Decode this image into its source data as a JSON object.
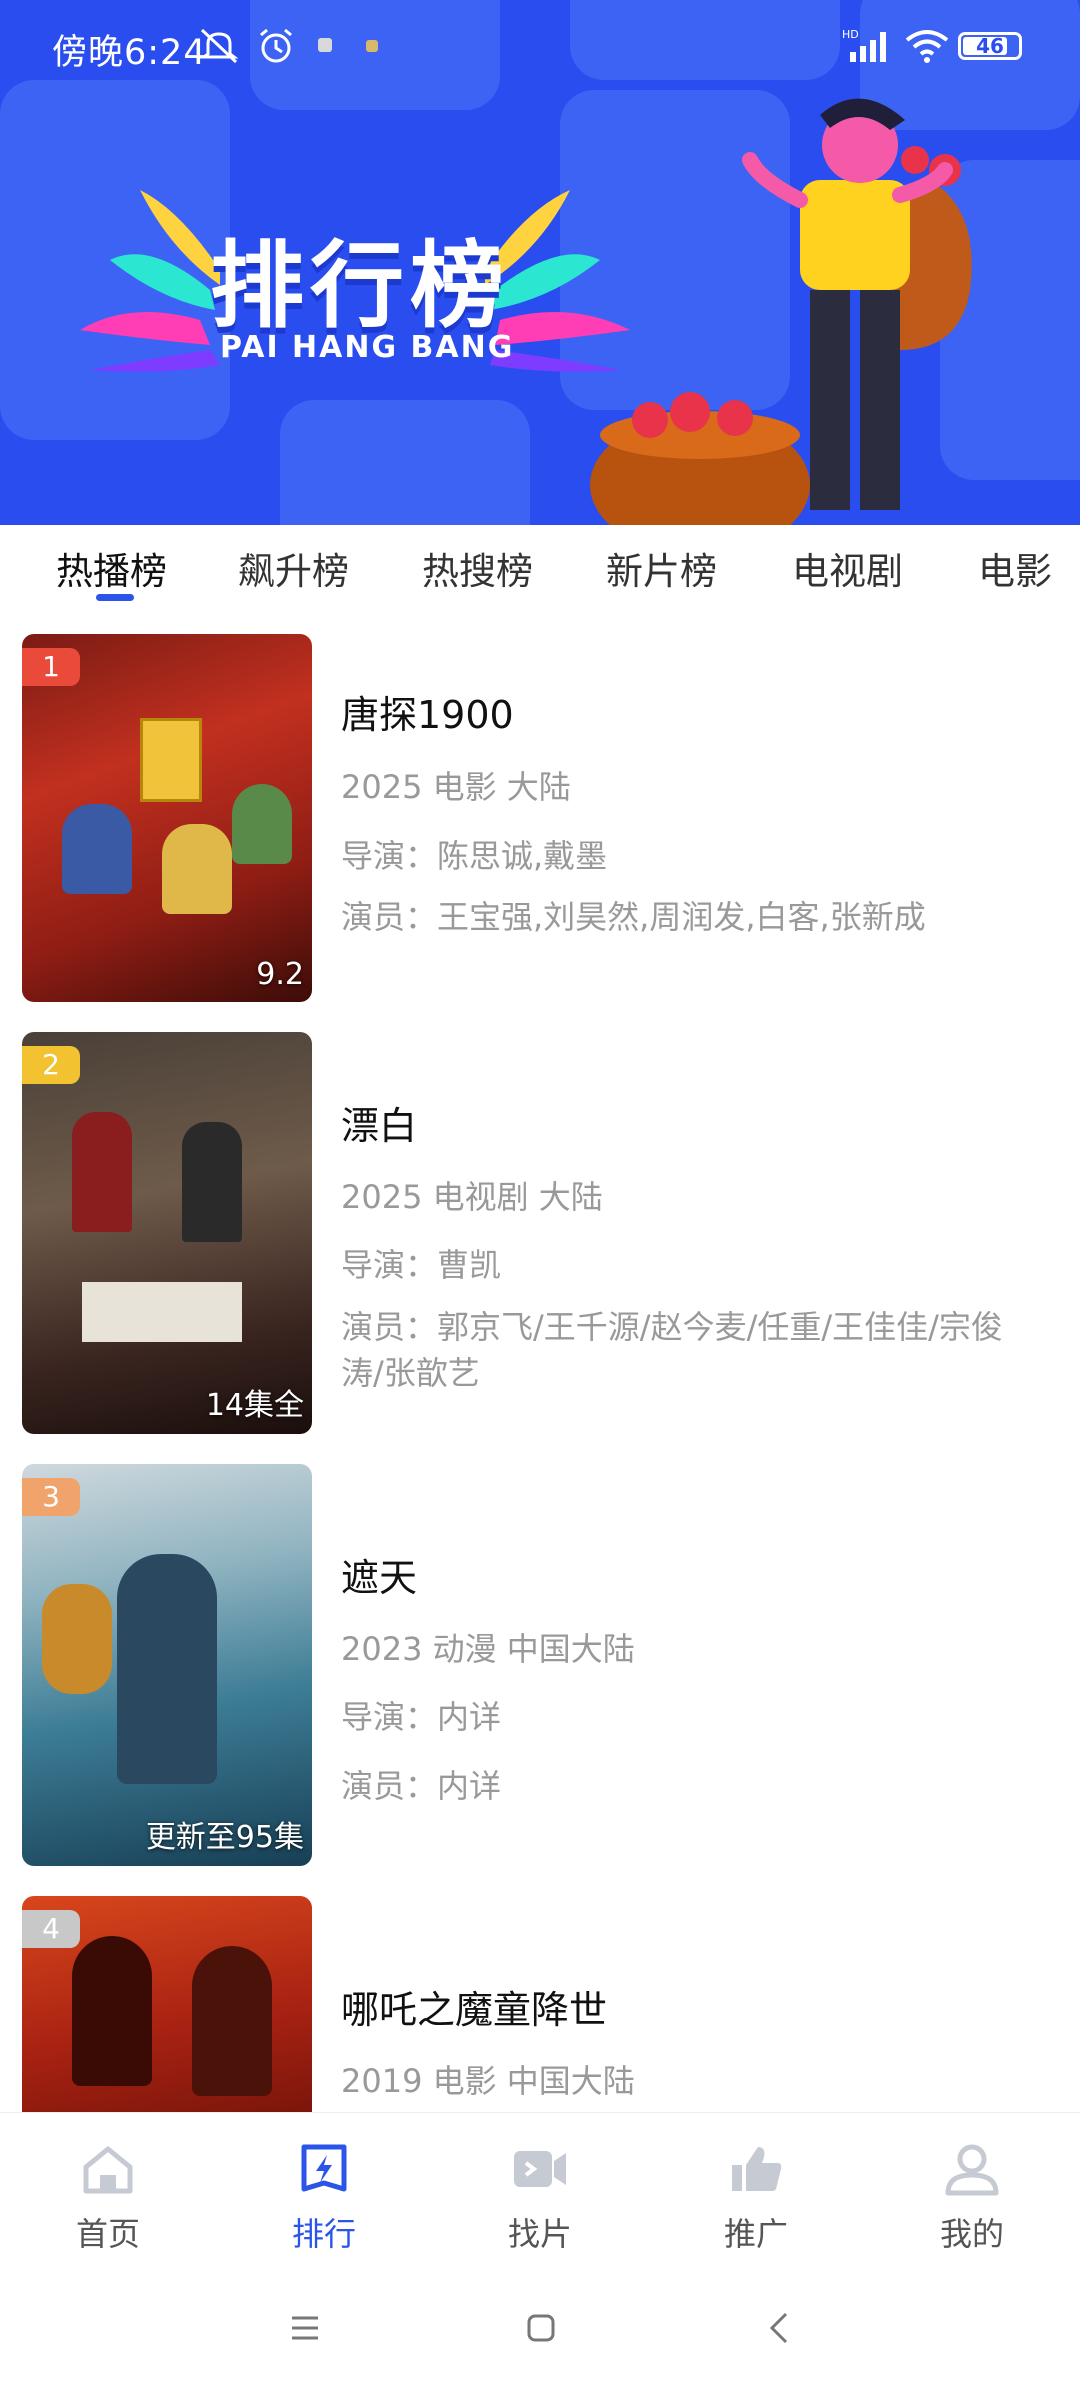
{
  "status_bar": {
    "time": "傍晚6:24",
    "battery": "46"
  },
  "banner": {
    "title": "排行榜",
    "subtitle": "PAI HANG BANG"
  },
  "tabs": [
    "热播榜",
    "飙升榜",
    "热搜榜",
    "新片榜",
    "电视剧",
    "电影"
  ],
  "items": [
    {
      "rank": "1",
      "title": "唐探1900",
      "meta": "2025 电影 大陆",
      "director": "导演：陈思诚,戴墨",
      "cast": "演员：王宝强,刘昊然,周润发,白客,张新成",
      "badge": "9.2"
    },
    {
      "rank": "2",
      "title": "漂白",
      "meta": "2025 电视剧 大陆",
      "director": "导演：曹凯",
      "cast": "演员：郭京飞/王千源/赵今麦/任重/王佳佳/宗俊涛/张歆艺",
      "badge": "14集全"
    },
    {
      "rank": "3",
      "title": "遮天",
      "meta": "2023 动漫 中国大陆",
      "director": "导演：内详",
      "cast": "演员：内详",
      "badge": "更新至95集"
    },
    {
      "rank": "4",
      "title": "哪吒之魔童降世",
      "meta": "2019 电影 中国大陆"
    }
  ],
  "rank_colors": {
    "r1": "#e94a3a",
    "r2": "#f2c230",
    "r3": "#f0a36a",
    "r4": "#c8c8c8"
  },
  "bottom_nav": [
    {
      "label": "首页",
      "icon": "home-icon"
    },
    {
      "label": "排行",
      "icon": "ranking-icon"
    },
    {
      "label": "找片",
      "icon": "video-icon"
    },
    {
      "label": "推广",
      "icon": "thumbs-up-icon"
    },
    {
      "label": "我的",
      "icon": "user-icon"
    }
  ],
  "colors": {
    "primary": "#2a4df0",
    "accent": "#2a55e8",
    "inactive": "#c6cad3"
  }
}
